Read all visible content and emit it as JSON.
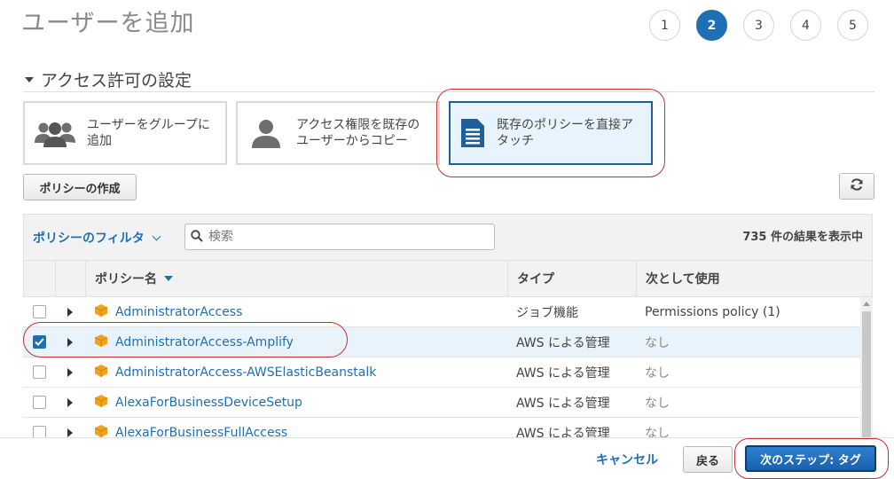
{
  "header": {
    "title": "ユーザーを追加"
  },
  "steps": [
    "1",
    "2",
    "3",
    "4",
    "5"
  ],
  "active_step": "2",
  "section": {
    "title": "アクセス許可の設定"
  },
  "options": [
    {
      "label": "ユーザーをグループに追加",
      "icon": "users-group-icon"
    },
    {
      "label": "アクセス権限を既存のユーザーからコピー",
      "icon": "user-icon"
    },
    {
      "label": "既存のポリシーを直接アタッチ",
      "icon": "document-icon",
      "selected": true
    }
  ],
  "toolbar": {
    "create_policy_label": "ポリシーの作成",
    "refresh_icon": "refresh-icon"
  },
  "filter": {
    "toggle_label": "ポリシーのフィルタ",
    "search_placeholder": "検索",
    "result_count": "735 件の結果を表示中"
  },
  "table": {
    "columns": [
      "ポリシー名",
      "タイプ",
      "次として使用"
    ],
    "rows": [
      {
        "name": "AdministratorAccess",
        "type": "ジョブ機能",
        "used_as": "Permissions policy (1)",
        "checked": false
      },
      {
        "name": "AdministratorAccess-Amplify",
        "type": "AWS による管理",
        "used_as": "なし",
        "checked": true
      },
      {
        "name": "AdministratorAccess-AWSElasticBeanstalk",
        "type": "AWS による管理",
        "used_as": "なし",
        "checked": false
      },
      {
        "name": "AlexaForBusinessDeviceSetup",
        "type": "AWS による管理",
        "used_as": "なし",
        "checked": false
      },
      {
        "name": "AlexaForBusinessFullAccess",
        "type": "AWS による管理",
        "used_as": "なし",
        "checked": false
      }
    ]
  },
  "footer": {
    "cancel_label": "キャンセル",
    "back_label": "戻る",
    "next_label": "次のステップ: タグ"
  },
  "colors": {
    "accent": "#1f6fb5",
    "policy_icon": "#f4a219",
    "annotation": "#c53030",
    "selected_row": "#e8f3fc"
  }
}
